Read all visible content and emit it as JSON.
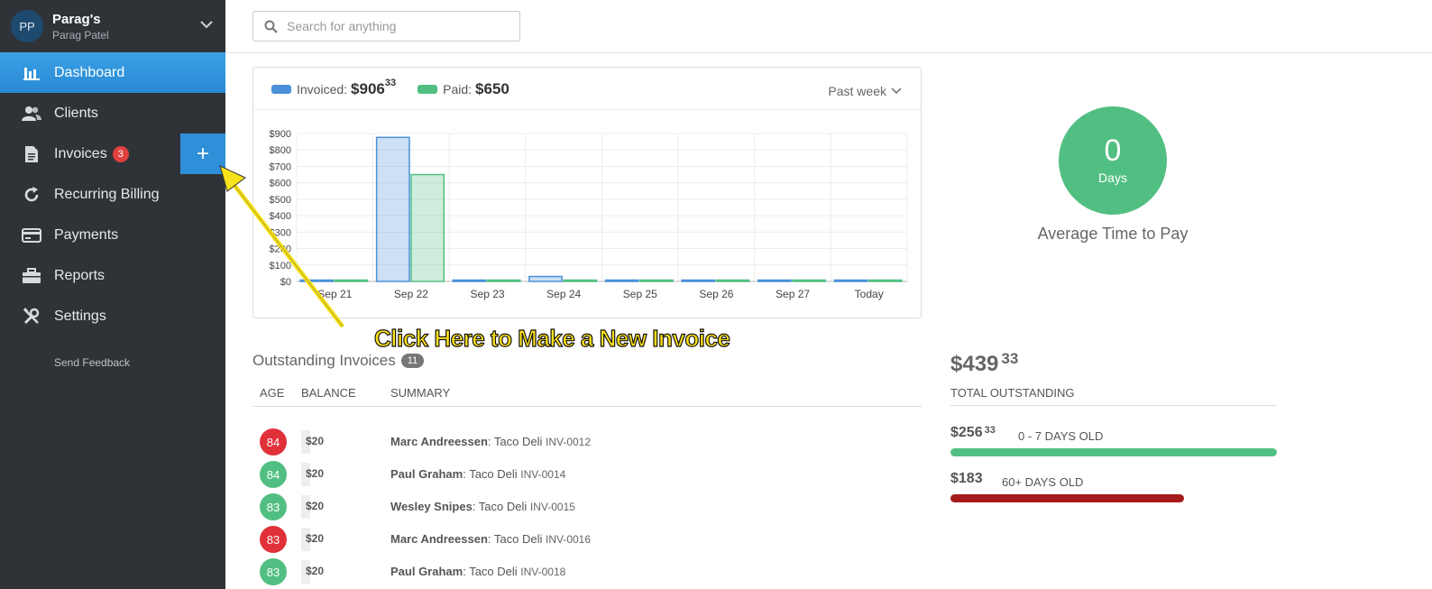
{
  "account": {
    "initials": "PP",
    "name": "Parag's",
    "user": "Parag Patel"
  },
  "sidebar": {
    "items": [
      {
        "label": "Dashboard",
        "icon": "bar-chart-icon"
      },
      {
        "label": "Clients",
        "icon": "users-icon"
      },
      {
        "label": "Invoices",
        "icon": "document-icon",
        "badge": "3"
      },
      {
        "label": "Recurring Billing",
        "icon": "refresh-icon"
      },
      {
        "label": "Payments",
        "icon": "credit-card-icon"
      },
      {
        "label": "Reports",
        "icon": "briefcase-icon"
      },
      {
        "label": "Settings",
        "icon": "tools-icon"
      }
    ],
    "new_invoice_label": "+",
    "feedback": "Send Feedback"
  },
  "search": {
    "placeholder": "Search for anything"
  },
  "chart": {
    "legend_invoiced_label": "Invoiced:",
    "legend_invoiced_amount": "$906",
    "legend_invoiced_cents": "33",
    "legend_paid_label": "Paid:",
    "legend_paid_amount": "$650",
    "range": "Past week"
  },
  "chart_data": {
    "type": "bar",
    "categories": [
      "Sep 21",
      "Sep 22",
      "Sep 23",
      "Sep 24",
      "Sep 25",
      "Sep 26",
      "Sep 27",
      "Today"
    ],
    "series": [
      {
        "name": "Invoiced",
        "values": [
          0,
          876.33,
          0,
          30,
          0,
          0,
          0,
          0
        ]
      },
      {
        "name": "Paid",
        "values": [
          0,
          650,
          0,
          0,
          0,
          0,
          0,
          0
        ]
      }
    ],
    "yticks": [
      "$0",
      "$100",
      "$200",
      "$300",
      "$400",
      "$500",
      "$600",
      "$700",
      "$800",
      "$900"
    ],
    "ylim": [
      0,
      900
    ],
    "grid": true,
    "colors": {
      "invoiced": "#4a90d9",
      "paid": "#52bf82"
    }
  },
  "widget": {
    "days_value": "0",
    "days_unit": "Days",
    "caption": "Average Time to Pay"
  },
  "annotation": "Click Here to Make a New Invoice",
  "outstanding": {
    "title": "Outstanding Invoices",
    "count": "11",
    "columns": {
      "age": "AGE",
      "balance": "BALANCE",
      "summary": "SUMMARY"
    },
    "rows": [
      {
        "age": "84",
        "status": "overdue",
        "balance": "$20",
        "client": "Marc Andreessen",
        "item": ": Taco Deli",
        "inv": "INV-0012"
      },
      {
        "age": "84",
        "status": "ok",
        "balance": "$20",
        "client": "Paul Graham",
        "item": ": Taco Deli",
        "inv": "INV-0014"
      },
      {
        "age": "83",
        "status": "ok",
        "balance": "$20",
        "client": "Wesley Snipes",
        "item": ": Taco Deli",
        "inv": "INV-0015"
      },
      {
        "age": "83",
        "status": "overdue",
        "balance": "$20",
        "client": "Marc Andreessen",
        "item": ": Taco Deli",
        "inv": "INV-0016"
      },
      {
        "age": "83",
        "status": "ok",
        "balance": "$20",
        "client": "Paul Graham",
        "item": ": Taco Deli",
        "inv": "INV-0018"
      }
    ]
  },
  "totals": {
    "amount": "$439",
    "cents": "33",
    "label": "TOTAL OUTSTANDING",
    "bucket_new_amount": "$256",
    "bucket_new_cents": "33",
    "bucket_new_label": "0 - 7 DAYS OLD",
    "bucket_old_amount": "$183",
    "bucket_old_label": "60+ DAYS OLD"
  },
  "colors": {
    "accent": "#2f8fd8",
    "green": "#52bf82",
    "red": "#e0313a",
    "dark_red": "#a61c1c",
    "sidebar": "#2f3338"
  }
}
